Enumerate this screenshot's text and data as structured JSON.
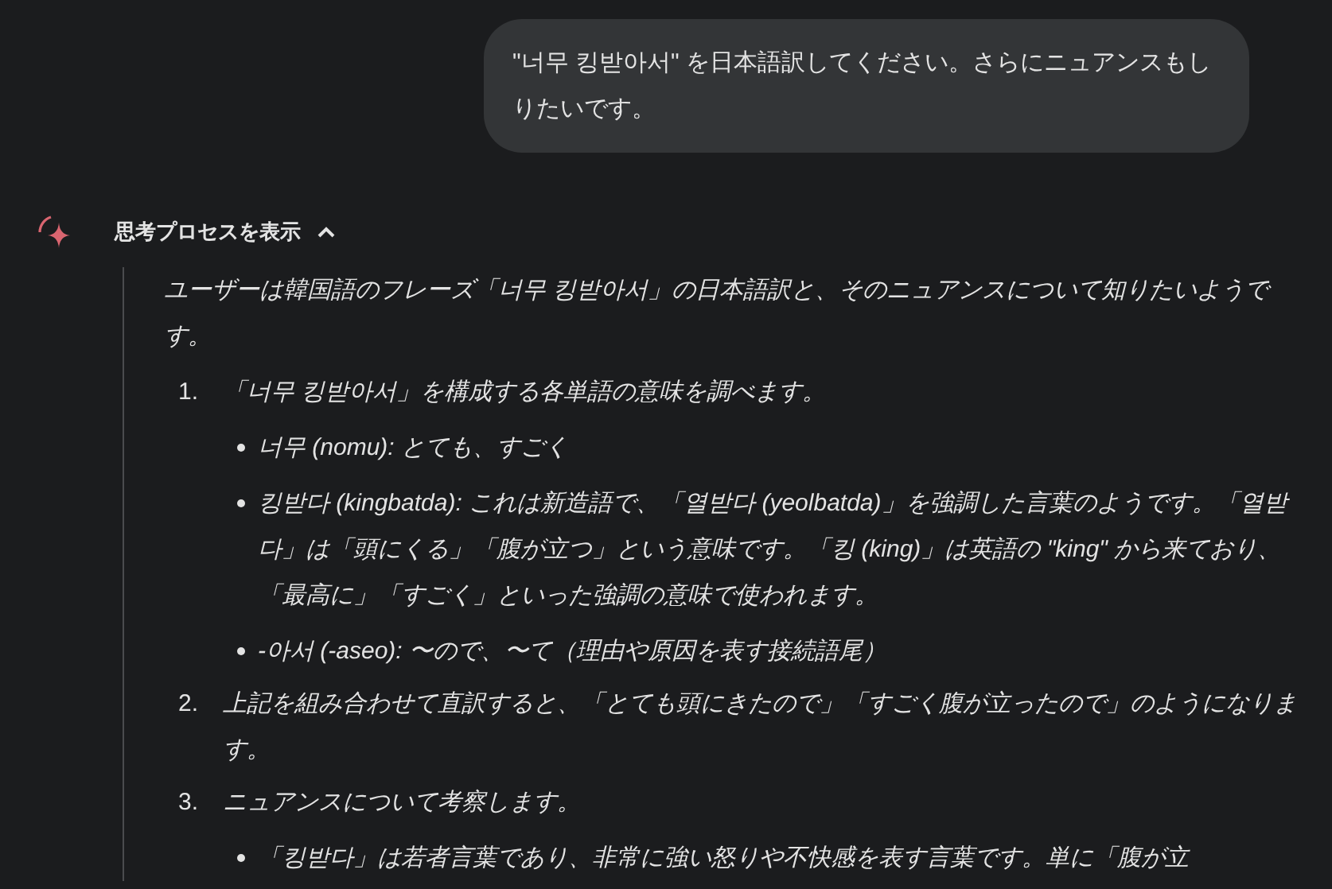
{
  "user_message": {
    "text": "\"너무 킹받아서\" を日本語訳してください。さらにニュアンスもしりたいです。"
  },
  "thinking": {
    "label": "思考プロセスを表示",
    "expanded": true,
    "intro": "ユーザーは韓国語のフレーズ「너무 킹받아서」の日本語訳と、そのニュアンスについて知りたいようです。",
    "steps": [
      {
        "number": "1.",
        "text": "「너무 킹받아서」を構成する各単語の意味を調べます。",
        "children": [
          {
            "text": "너무 (nomu): とても、すごく"
          },
          {
            "text": "킹받다 (kingbatda): これは新造語で、「열받다 (yeolbatda)」を強調した言葉のようです。「열받다」は「頭にくる」「腹が立つ」という意味です。「킹 (king)」は英語の \"king\" から来ており、「最高に」「すごく」といった強調の意味で使われます。"
          },
          {
            "text": "-아서 (-aseo): 〜ので、〜て（理由や原因を表す接続語尾）"
          }
        ]
      },
      {
        "number": "2.",
        "text": "上記を組み合わせて直訳すると、「とても頭にきたので」「すごく腹が立ったので」のようになります。"
      },
      {
        "number": "3.",
        "text": "ニュアンスについて考察します。",
        "children": [
          {
            "text": "「킹받다」は若者言葉であり、非常に強い怒りや不快感を表す言葉です。単に「腹が立"
          }
        ]
      }
    ]
  }
}
